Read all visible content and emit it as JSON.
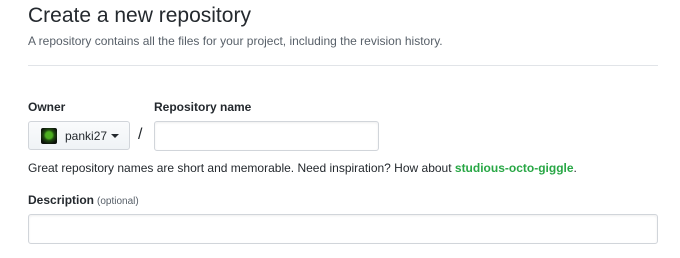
{
  "header": {
    "title": "Create a new repository",
    "subtitle": "A repository contains all the files for your project, including the revision history."
  },
  "form": {
    "owner_label": "Owner",
    "owner_value": "panki27",
    "separator": "/",
    "repo_name_label": "Repository name",
    "repo_name_value": "",
    "name_hint_prefix": "Great repository names are short and memorable. Need inspiration? How about ",
    "name_suggestion": "studious-octo-giggle",
    "name_hint_suffix": ".",
    "description_label": "Description",
    "description_optional": "(optional)",
    "description_value": ""
  },
  "colors": {
    "accent_green": "#28a745",
    "text": "#24292e",
    "muted": "#586069",
    "border": "#d1d5da"
  },
  "icons": {
    "owner_avatar": "avatar-icon",
    "owner_dropdown": "caret-down-icon"
  }
}
